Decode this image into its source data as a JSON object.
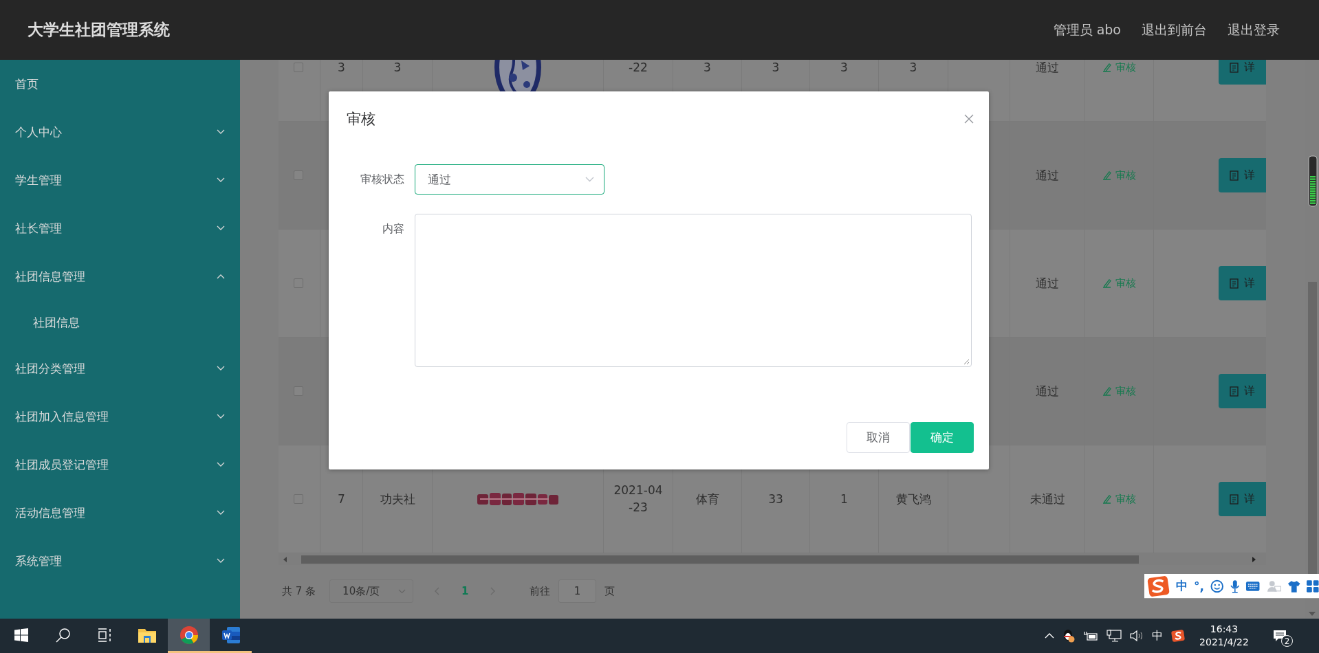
{
  "header": {
    "title": "大学生社团管理系统",
    "links": [
      {
        "label": "管理员 abo"
      },
      {
        "label": "退出到前台"
      },
      {
        "label": "退出登录"
      }
    ]
  },
  "sidebar": {
    "items": [
      {
        "kind": "link",
        "label": "首页"
      },
      {
        "kind": "submenu",
        "label": "个人中心",
        "expanded": false
      },
      {
        "kind": "submenu",
        "label": "学生管理",
        "expanded": false
      },
      {
        "kind": "submenu",
        "label": "社长管理",
        "expanded": false
      },
      {
        "kind": "submenu",
        "label": "社团信息管理",
        "expanded": true,
        "children": [
          {
            "label": "社团信息"
          }
        ]
      },
      {
        "kind": "submenu",
        "label": "社团分类管理",
        "expanded": false
      },
      {
        "kind": "submenu",
        "label": "社团加入信息管理",
        "expanded": false
      },
      {
        "kind": "submenu",
        "label": "社团成员登记管理",
        "expanded": false
      },
      {
        "kind": "submenu",
        "label": "活动信息管理",
        "expanded": false
      },
      {
        "kind": "submenu",
        "label": "系统管理",
        "expanded": false
      }
    ]
  },
  "table": {
    "rows": [
      {
        "checked": false,
        "cells": [
          {
            "kind": "text",
            "text": "3"
          },
          {
            "kind": "text",
            "text": "3"
          },
          {
            "kind": "picture"
          },
          {
            "kind": "text",
            "text": "-22"
          },
          {
            "kind": "text",
            "text": "3"
          },
          {
            "kind": "text",
            "text": "3"
          },
          {
            "kind": "text",
            "text": "3"
          },
          {
            "kind": "text",
            "text": "3"
          }
        ],
        "status": "通过",
        "audit": "审核",
        "detail": "详"
      },
      {
        "checked": false,
        "status": "通过",
        "audit": "审核",
        "detail": "详"
      },
      {
        "checked": false,
        "status": "通过",
        "audit": "审核",
        "detail": "详"
      },
      {
        "checked": false,
        "status": "通过",
        "audit": "审核",
        "detail": "详"
      },
      {
        "checked": false,
        "cells": [
          {
            "kind": "text",
            "text": "7"
          },
          {
            "kind": "text",
            "text": "功夫社"
          },
          {
            "kind": "picture"
          },
          {
            "kind": "text",
            "text": "2021-04-23"
          },
          {
            "kind": "text",
            "text": "体育"
          },
          {
            "kind": "text",
            "text": "33"
          },
          {
            "kind": "text",
            "text": "1"
          },
          {
            "kind": "text",
            "text": "黄飞鸿"
          }
        ],
        "status": "未通过",
        "audit": "审核",
        "detail": "详"
      }
    ]
  },
  "pagination": {
    "total": "共 7 条",
    "page_size": "10条/页",
    "pages": [
      {
        "label": "1",
        "selected": true
      }
    ],
    "goto_label": "前往",
    "goto_value": "1",
    "goto_suffix": "页"
  },
  "dialog": {
    "title": "审核",
    "fields": [
      {
        "kind": "select",
        "label": "审核状态",
        "value": "通过"
      },
      {
        "kind": "textarea",
        "label": "内容"
      }
    ],
    "buttons": [
      {
        "kind": "default",
        "label": "取消"
      },
      {
        "kind": "primary",
        "label": "确定"
      }
    ]
  },
  "ime_toolbar": {
    "mode": "中",
    "punctuation": "°,"
  },
  "taskbar": {
    "apps": [
      {
        "kind": "explorer",
        "selected": false,
        "running": false
      },
      {
        "kind": "chrome",
        "selected": true,
        "running": true
      },
      {
        "kind": "word",
        "selected": false,
        "running": true
      }
    ],
    "tray": {
      "input_mode": "中",
      "time": "16:43",
      "date": "2021/4/22",
      "notifications": "2"
    }
  }
}
